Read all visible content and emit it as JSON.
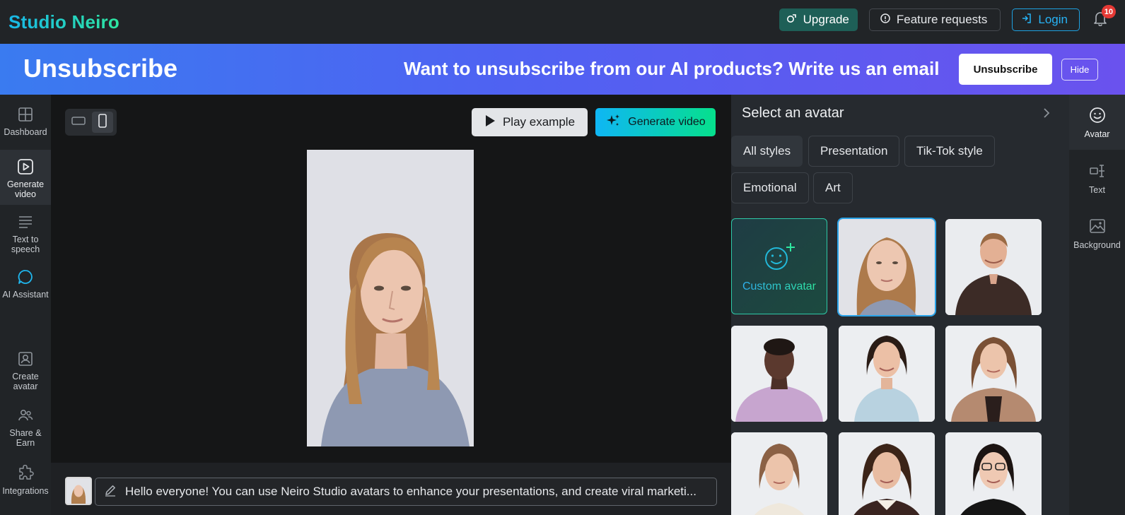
{
  "header": {
    "logo": "Studio Neiro",
    "upgrade_label": "Upgrade",
    "feature_label": "Feature requests",
    "login_label": "Login",
    "notification_count": "10"
  },
  "banner": {
    "title": "Unsubscribe",
    "message": "Want to unsubscribe from our AI products? Write us an email",
    "unsubscribe_label": "Unsubscribe",
    "hide_label": "Hide"
  },
  "sidebar": {
    "items": [
      {
        "label": "Dashboard",
        "icon": "grid-icon"
      },
      {
        "label": "Generate video",
        "icon": "play-square-icon"
      },
      {
        "label": "Text to speech",
        "icon": "lines-icon"
      },
      {
        "label": "AI Assistant",
        "icon": "chat-bubble-icon"
      },
      {
        "label": "Create avatar",
        "icon": "user-frame-icon"
      },
      {
        "label": "Share & Earn",
        "icon": "users-icon"
      },
      {
        "label": "Integrations",
        "icon": "puzzle-icon"
      }
    ]
  },
  "stage": {
    "play_label": "Play example",
    "generate_label": "Generate video",
    "script_text": "Hello everyone! You can use Neiro Studio avatars to enhance your presentations, and create viral marketi..."
  },
  "panel": {
    "title": "Select an avatar",
    "filters": [
      "All styles",
      "Presentation",
      "Tik-Tok style",
      "Emotional",
      "Art"
    ],
    "custom_label": "Custom avatar"
  },
  "rail": {
    "items": [
      {
        "label": "Avatar",
        "icon": "smiley-icon"
      },
      {
        "label": "Text",
        "icon": "text-cursor-icon"
      },
      {
        "label": "Background",
        "icon": "image-icon"
      }
    ]
  },
  "colors": {
    "accent_blue": "#27b3f5",
    "accent_green": "#2ee6a0",
    "banner_start": "#3a7bf0",
    "banner_end": "#6a52ee",
    "badge_red": "#e53935"
  }
}
